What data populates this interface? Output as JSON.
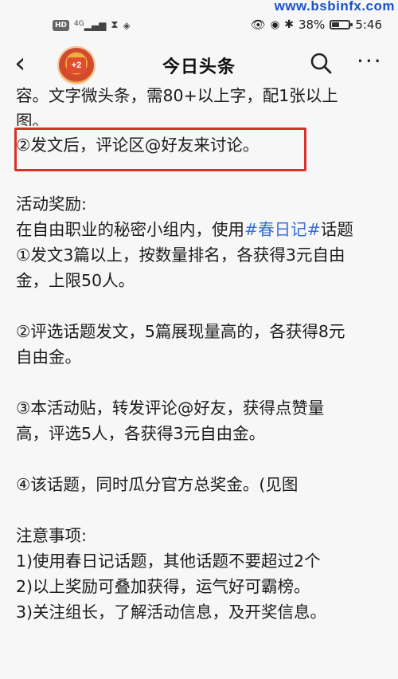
{
  "status_bar": {
    "chip1": "HD",
    "signal": "4G",
    "battery_percent": "38%",
    "battery_level": 0.38,
    "time": "5:46"
  },
  "watermark": "www.bsbinfx.com",
  "nav": {
    "back_glyph": "‹",
    "avatar_badge": "+2",
    "title": "今日头条",
    "more_glyph": "···"
  },
  "article": {
    "intro_line1": "容。文字微头条，需80+以上字，配1张以上",
    "intro_line2": "图。",
    "point2": "②发文后，评论区@好友来讨论。",
    "rewards_heading": "活动奖励:",
    "rewards_intro_prefix": "在自由职业的秘密小组内，使用",
    "rewards_hashtag": "#春日记#",
    "rewards_intro_suffix": "话题",
    "reward1_line1": "①发文3篇以上，按数量排名，各获得3元自由",
    "reward1_line2": "金，上限50人。",
    "reward2_line1": "②评选话题发文，5篇展现量高的，各获得8元",
    "reward2_line2": "自由金。",
    "reward3_line1": "③本活动贴，转发评论@好友，获得点赞量",
    "reward3_line2": "高，评选5人，各获得3元自由金。",
    "reward4": "④该话题，同时瓜分官方总奖金。(见图",
    "notes_heading": "注意事项:",
    "note1": "1)使用春日记话题，其他话题不要超过2个",
    "note2": "2)以上奖励可叠加获得，运气好可霸榜。",
    "note3": "3)关注组长，了解活动信息，及开奖信息。"
  },
  "colors": {
    "highlight_border": "#d9302c",
    "hashtag": "#3a6fd8",
    "watermark": "#1a52c8"
  }
}
